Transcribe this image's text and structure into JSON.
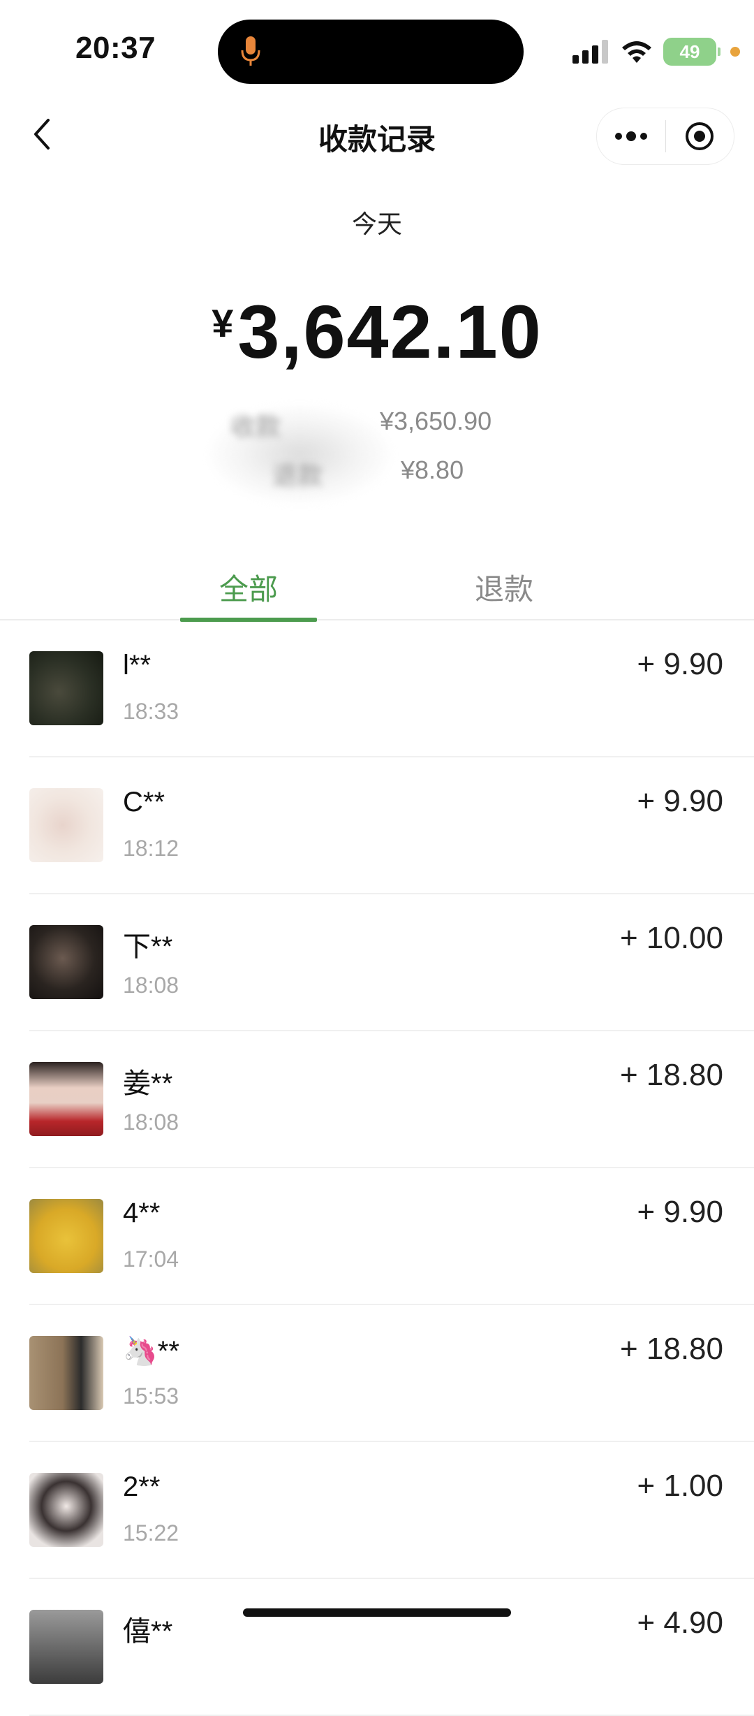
{
  "status_bar": {
    "time": "20:37",
    "battery": "49"
  },
  "nav": {
    "title": "收款记录"
  },
  "summary": {
    "date": "今天",
    "currency": "¥",
    "total": "3,642.10",
    "received_label": "收款",
    "received_value": "¥3,650.90",
    "refund_label": "退款",
    "refund_value": "¥8.80"
  },
  "tabs": {
    "all": "全部",
    "refund": "退款"
  },
  "records": [
    {
      "name": "l**",
      "time": "18:33",
      "amount": "+ 9.90"
    },
    {
      "name": "C**",
      "time": "18:12",
      "amount": "+ 9.90"
    },
    {
      "name": "下**",
      "time": "18:08",
      "amount": "+ 10.00"
    },
    {
      "name": "姜**",
      "time": "18:08",
      "amount": "+ 18.80"
    },
    {
      "name": "4**",
      "time": "17:04",
      "amount": "+ 9.90"
    },
    {
      "name": "🦄**",
      "time": "15:53",
      "amount": "+ 18.80"
    },
    {
      "name": "2**",
      "time": "15:22",
      "amount": "+ 1.00"
    },
    {
      "name": "僖**",
      "time": "",
      "amount": "+ 4.90"
    }
  ]
}
